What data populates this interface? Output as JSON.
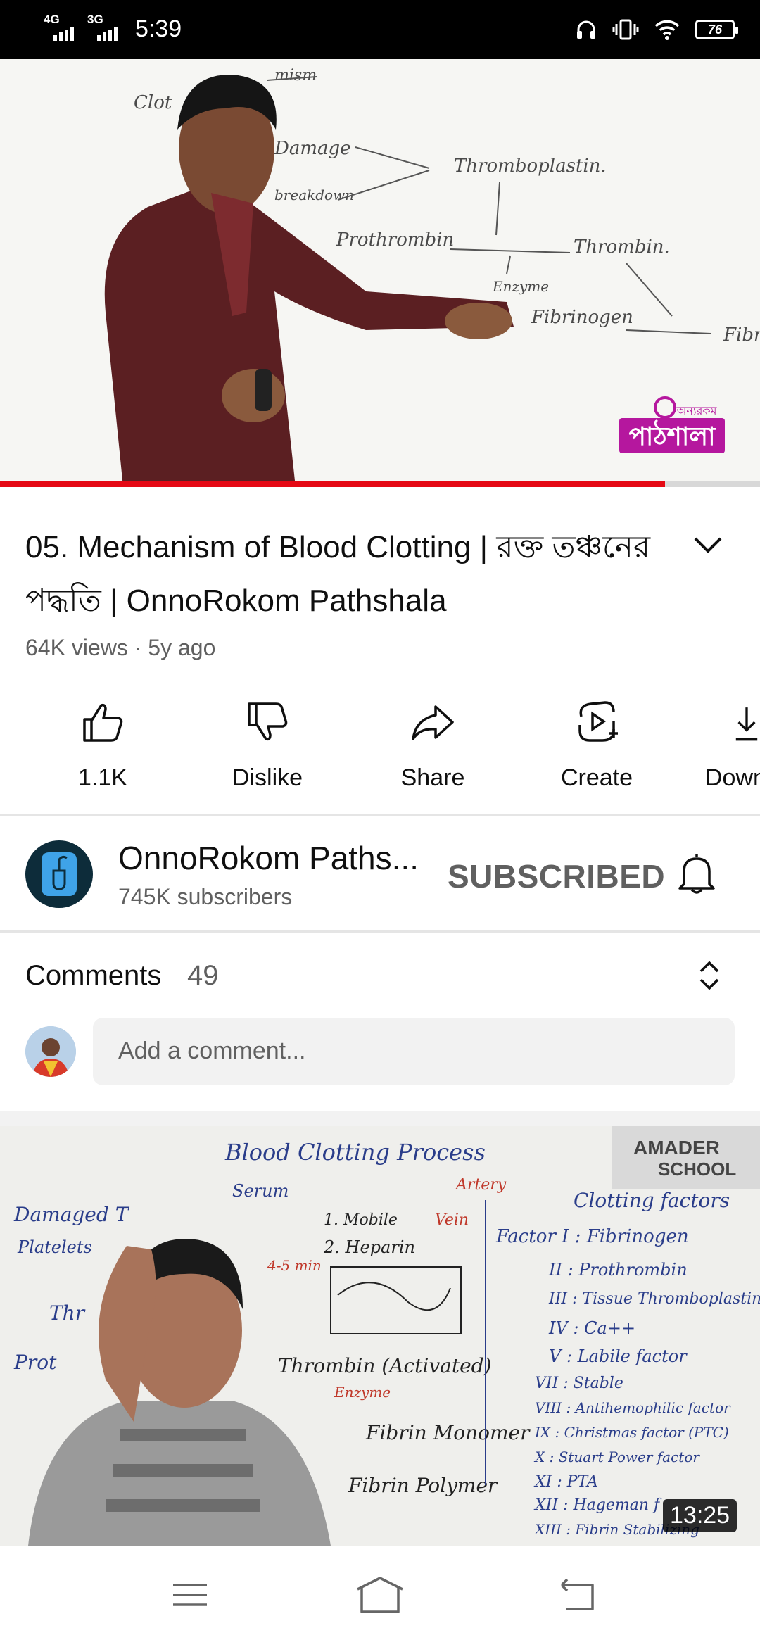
{
  "status_bar": {
    "net1": "4G",
    "net2": "3G",
    "time": "5:39",
    "battery": "76"
  },
  "player": {
    "progress": 0.875,
    "logo_text": "অন্যরকম",
    "logo_word": "পাঠশালা",
    "board_lines": {
      "l1": "Clot",
      "l2": "mism",
      "l3": "Damage",
      "l4": "breakdown",
      "l5": "Thromboplastin.",
      "l6": "Prothrombin",
      "l7": "Thrombin.",
      "l8": "Enzyme",
      "l9": "Fibrinogen",
      "l10": "Fibr"
    }
  },
  "video": {
    "title": "05. Mechanism of Blood Clotting | রক্ত তঞ্চনের পদ্ধতি | OnnoRokom Pathshala",
    "meta": "64K views · 5y ago"
  },
  "actions": {
    "like": "1.1K",
    "dislike": "Dislike",
    "share": "Share",
    "create": "Create",
    "download": "Down"
  },
  "channel": {
    "name": "OnnoRokom Paths...",
    "subscribers": "745K subscribers",
    "subscribe_label": "SUBSCRIBED"
  },
  "comments": {
    "label": "Comments",
    "count": "49",
    "placeholder": "Add a comment..."
  },
  "next_video": {
    "duration": "13:25",
    "brand": "AMADER",
    "brand2": "SCHOOL",
    "board": {
      "b1": "Blood Clotting Process",
      "b2": "Serum",
      "b3": "Artery",
      "b4": "Vein",
      "b5": "1. Mobile",
      "b6": "2. Heparin",
      "b7": "Damaged T",
      "b8": "Platelets",
      "b9": "Thrombin (Activated)",
      "b10": "Enzyme",
      "b11": "Fibrin Monomer",
      "b12": "Fibrin Polymer",
      "b13": "Clotting factors",
      "b14": "Factor I : Fibrinogen",
      "b15": "II : Prothrombin",
      "b16": "III : Tissue Thromboplastin",
      "b17": "IV : Ca++",
      "b18": "V : Labile factor",
      "b19": "VII : Stable",
      "b20": "VIII : Antihemophilic factor",
      "b21": "IX : Christmas factor (PTC)",
      "b22": "X : Stuart Power factor",
      "b23": "XI : PTA",
      "b24": "XII : Hageman f",
      "b25": "XIII : Fibrin Stabilizing",
      "b26": "4-5 min",
      "b27": "Prot",
      "b28": "Thr"
    }
  }
}
